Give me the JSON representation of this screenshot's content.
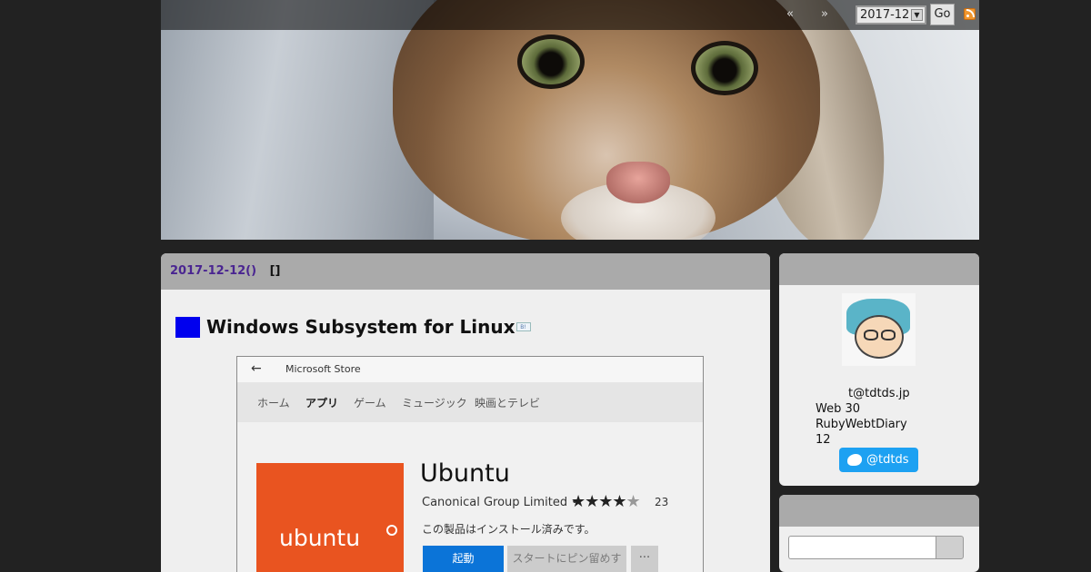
{
  "nav": {
    "prev": "«",
    "next": "»",
    "month_value": "2017-12",
    "go_label": "Go",
    "rss_icon": "rss-icon"
  },
  "entry": {
    "date": "2017-12-12()",
    "category": "[]",
    "section_title": "Windows Subsystem for Linux"
  },
  "store_screenshot": {
    "window_title": "Microsoft Store",
    "tabs": [
      "ホーム",
      "アプリ",
      "ゲーム",
      "ミュージック",
      "映画とテレビ"
    ],
    "active_tab": "アプリ",
    "tile_text": "ubuntu",
    "app_name": "Ubuntu",
    "publisher": "Canonical Group Limited  •",
    "rating_stars": "★★★★",
    "rating_dim_star": "★",
    "rating_count": "23",
    "installed_note": "この製品はインストール済みです。",
    "launch_label": "起動",
    "pin_label": "スタートにピン留めする",
    "more_label": "···",
    "colors": {
      "tile": "#e95420",
      "launch": "#0b74d8"
    }
  },
  "sidebar": {
    "profile_lines": [
      "t@tdtds.jp",
      "Web 30",
      "RubyWebtDiary",
      "12"
    ],
    "twitter_label": "@tdtds",
    "search_placeholder": ""
  },
  "colors": {
    "background": "#222222",
    "panel": "#efefef",
    "panel_header": "#aaaaaa",
    "date_link": "#4a2591",
    "section_mark": "#0000ee",
    "twitter": "#1da1f2"
  }
}
